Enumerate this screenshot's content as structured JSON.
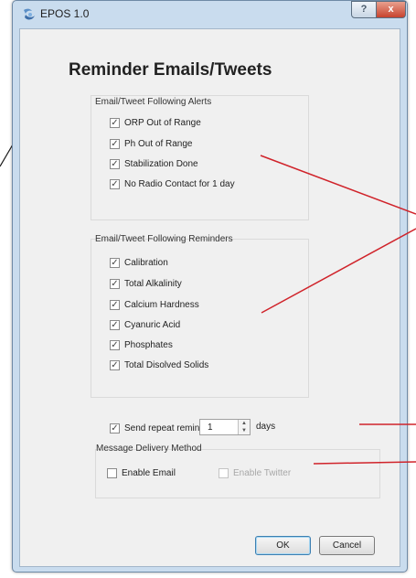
{
  "window": {
    "title": "EPOS 1.0",
    "help_label": "?",
    "close_label": "x"
  },
  "heading": "Reminder Emails/Tweets",
  "alerts": {
    "title": "Email/Tweet Following Alerts",
    "items": [
      {
        "label": "ORP Out of Range",
        "checked": true
      },
      {
        "label": "Ph Out of Range",
        "checked": true
      },
      {
        "label": "Stabilization Done",
        "checked": true
      },
      {
        "label": "No Radio Contact for 1 day",
        "checked": true
      }
    ]
  },
  "reminders": {
    "title": "Email/Tweet Following Reminders",
    "items": [
      {
        "label": "Calibration",
        "checked": true
      },
      {
        "label": "Total Alkalinity",
        "checked": true
      },
      {
        "label": "Calcium Hardness",
        "checked": true
      },
      {
        "label": "Cyanuric Acid",
        "checked": true
      },
      {
        "label": "Phosphates",
        "checked": true
      },
      {
        "label": "Total Disolved Solids",
        "checked": true
      }
    ]
  },
  "repeat": {
    "label": "Send repeat reminder every",
    "checked": true,
    "value": "1",
    "unit": "days"
  },
  "delivery": {
    "title": "Message Delivery Method",
    "email_label": "Enable Email",
    "email_checked": false,
    "twitter_label": "Enable Twitter",
    "twitter_checked": false
  },
  "buttons": {
    "ok": "OK",
    "cancel": "Cancel"
  },
  "colors": {
    "accent": "#d0232a",
    "frame": "#c9dcee",
    "close": "#c7432e"
  }
}
